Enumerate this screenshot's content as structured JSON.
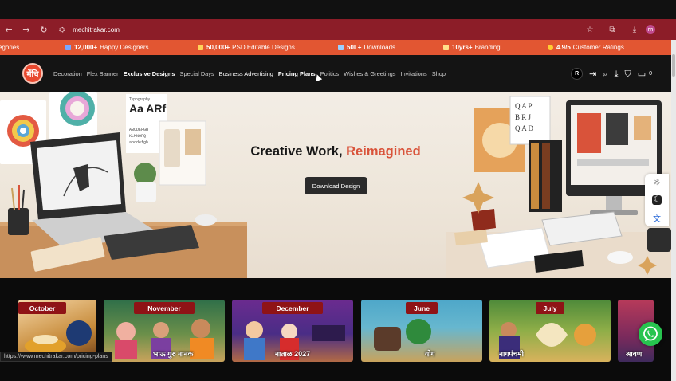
{
  "browser": {
    "url": "mechitrakar.com",
    "back_icon": "arrow-left",
    "forward_icon": "arrow-right",
    "reload_icon": "reload",
    "site_info_icon": "tune",
    "bookmark_icon": "star",
    "extensions_icon": "puzzle",
    "download_icon": "download",
    "profile_initial": "m",
    "menu_icon": "kebab"
  },
  "promo": {
    "items": [
      {
        "prefix": "",
        "text": "egories"
      },
      {
        "prefix": "12,000+",
        "text": "Happy Designers"
      },
      {
        "prefix": "50,000+",
        "text": "PSD Editable Designs"
      },
      {
        "prefix": "50L+",
        "text": "Downloads"
      },
      {
        "prefix": "10yrs+",
        "text": "Branding"
      },
      {
        "prefix": "4.9/5",
        "text": "Customer Ratings"
      }
    ]
  },
  "header": {
    "logo_text": "मेंचि",
    "menu": [
      "Decoration",
      "Flex Banner",
      "Exclusive Designs",
      "Special Days",
      "Business Advertising",
      "Pricing Plans",
      "Politics",
      "Wishes & Greetings",
      "Invitations",
      "Shop"
    ],
    "avatar_initial": "R",
    "cart_count": "0"
  },
  "hero": {
    "title_main": "Creative Work, ",
    "title_accent": "Reimagined",
    "button": "Download Design",
    "left_labels": {
      "typography": "Typography",
      "aa": "Aa ARf",
      "alphabet": "ABCDEFG HIJKLMN OPQRS"
    }
  },
  "cards": [
    {
      "tag": "October",
      "script": ""
    },
    {
      "tag": "November",
      "script": "भाऊ   गुरु नानक"
    },
    {
      "tag": "December",
      "script": "नाताळ  2027"
    },
    {
      "tag": "June",
      "script": "योग"
    },
    {
      "tag": "July",
      "script": "नागपंचमी"
    },
    {
      "tag": "",
      "script": "श्रावण"
    }
  ],
  "status_url": "https://www.mechitrakar.com/pricing-plans",
  "colors": {
    "brand_red": "#8c1d28",
    "promo_orange": "#e25632",
    "accent": "#d9533a",
    "whatsapp": "#27c44f"
  }
}
